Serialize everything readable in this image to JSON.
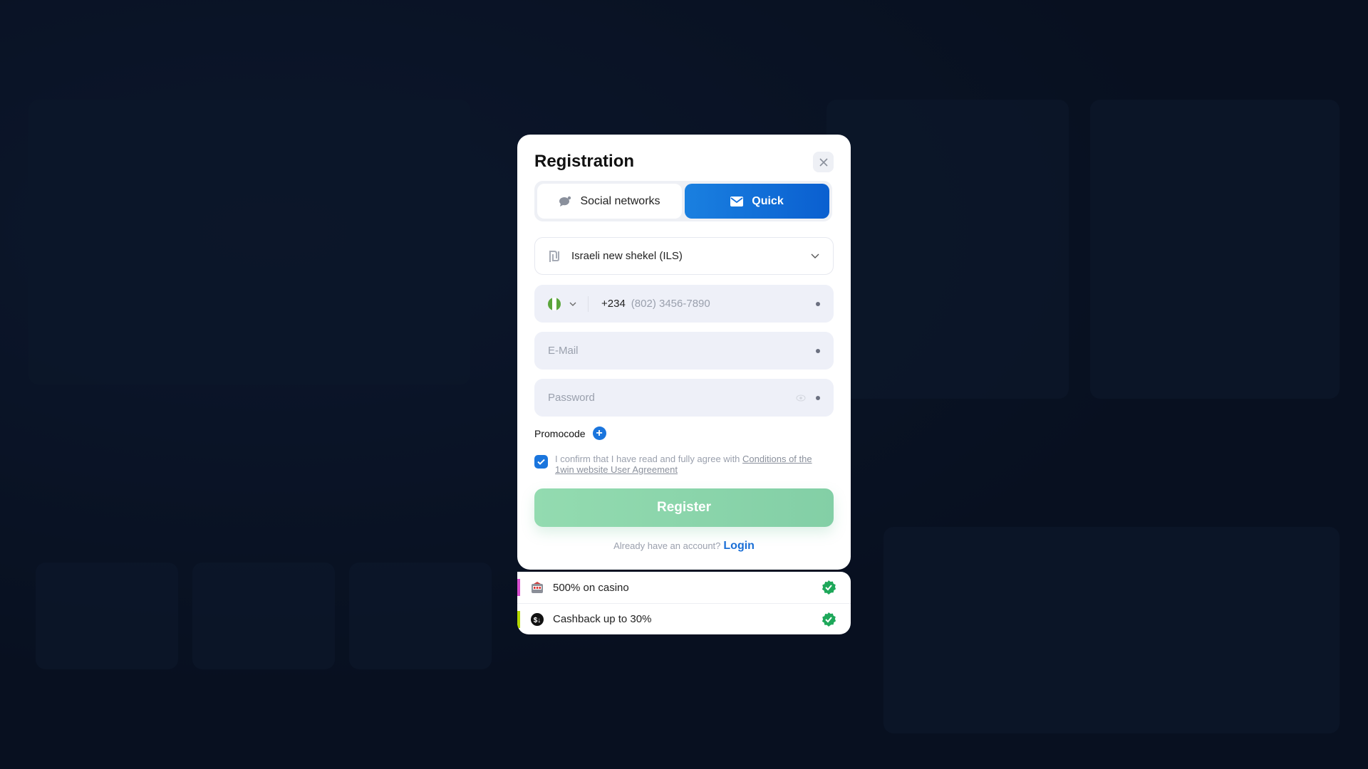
{
  "modal": {
    "title": "Registration",
    "close_icon": "close-icon",
    "tabs": [
      {
        "label": "Social networks",
        "icon": "chat-bubble-icon",
        "active": false
      },
      {
        "label": "Quick",
        "icon": "envelope-icon",
        "active": true
      }
    ],
    "currency": {
      "value": "Israeli new shekel (ILS)",
      "icon": "shekel-icon"
    },
    "phone": {
      "country_code": "+234",
      "placeholder": "(802) 3456-7890",
      "flag_colors": [
        "#5aa53a",
        "#ffffff",
        "#5aa53a"
      ]
    },
    "email": {
      "placeholder": "E-Mail"
    },
    "password": {
      "placeholder": "Password"
    },
    "promocode_label": "Promocode",
    "agreement": {
      "checked": true,
      "text": "I confirm that I have read and fully agree with ",
      "link": "Conditions of the 1win website User Agreement"
    },
    "register_label": "Register",
    "already_text": "Already have an account?",
    "login_label": "Login"
  },
  "bonuses": [
    {
      "label": "500% on casino",
      "icon": "slot-machine-icon",
      "accent": "#d94fd0"
    },
    {
      "label": "Cashback up to 30%",
      "icon": "cashback-coin-icon",
      "accent": "#b5d800"
    }
  ],
  "colors": {
    "accent": "#1a75dd",
    "register": "#8dd6ab",
    "check": "#1ea85a"
  }
}
